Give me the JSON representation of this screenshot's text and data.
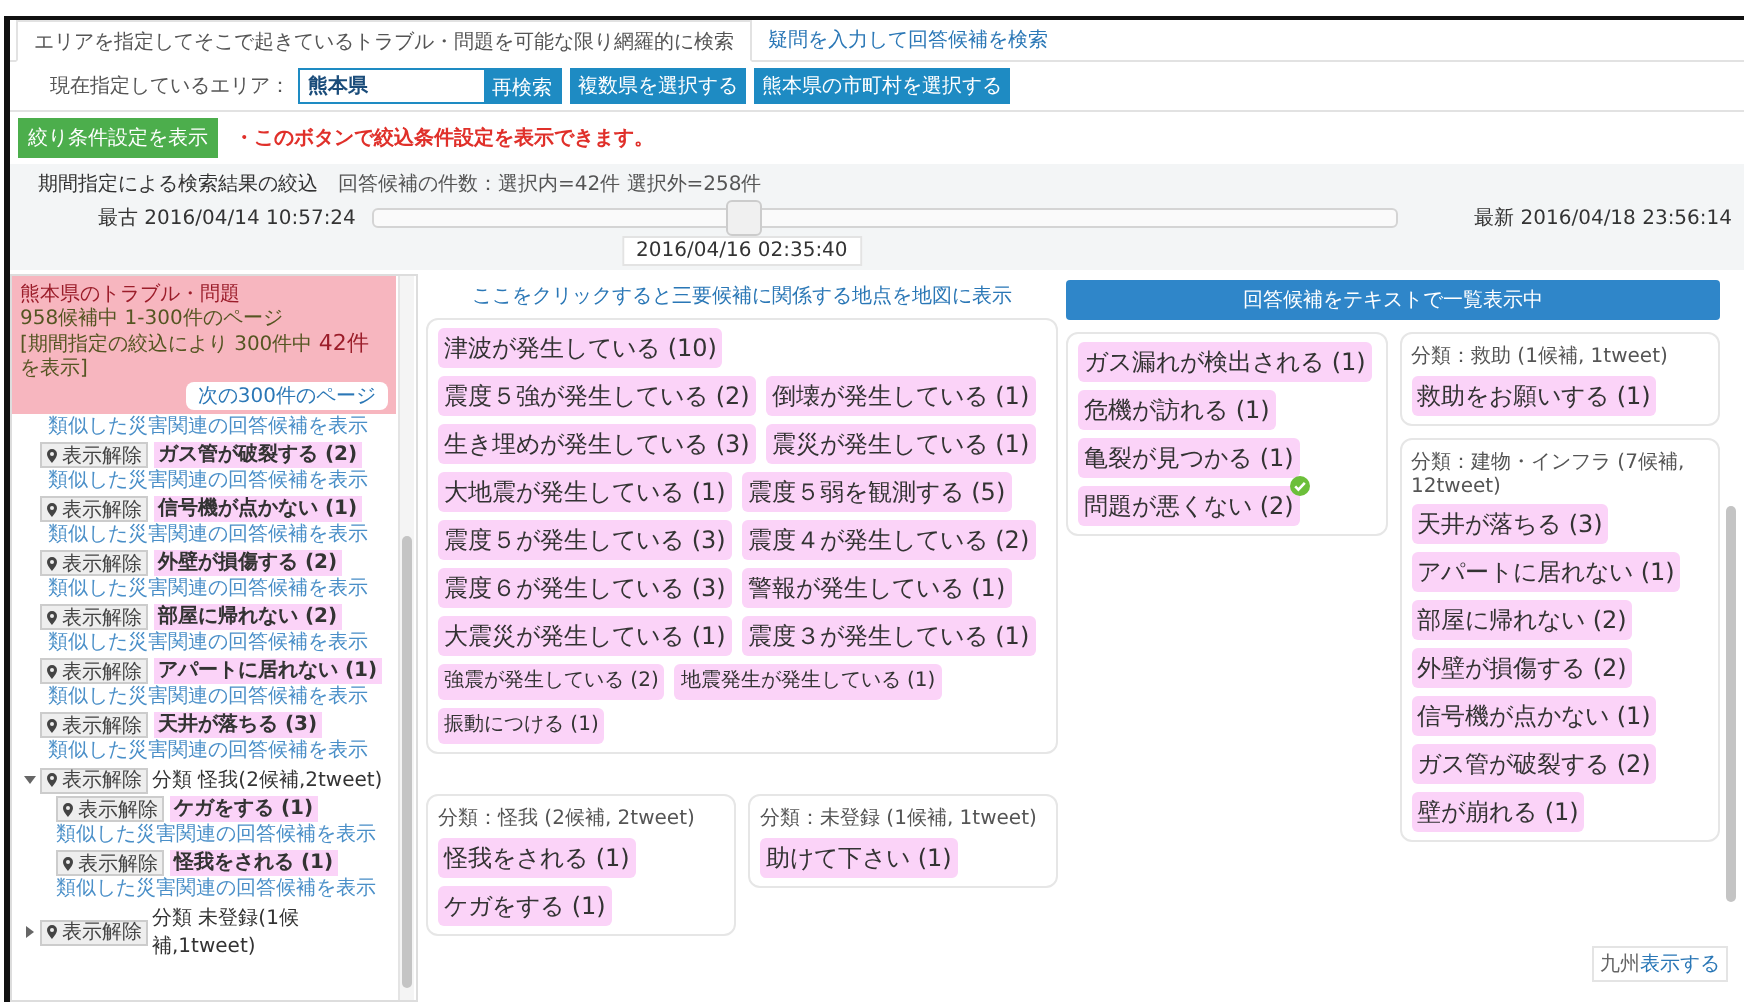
{
  "tabs": [
    {
      "label": "エリアを指定してそこで起きているトラブル・問題を可能な限り網羅的に検索",
      "selected": true
    },
    {
      "label": "疑問を入力して回答候補を検索",
      "selected": false
    }
  ],
  "area": {
    "label": "現在指定しているエリア：",
    "value": "熊本県",
    "buttons": [
      "再検索",
      "複数県を選択する",
      "熊本県の市町村を選択する"
    ]
  },
  "filter": {
    "button": "絞り条件設定を表示",
    "hint": "・このボタンで絞込条件設定を表示できます。"
  },
  "period": {
    "title": "期間指定による検索結果の絞込",
    "counts": "回答候補の件数：選択内=42件 選択外=258件",
    "oldest": "最古 2016/04/14 10:57:24",
    "newest": "最新 2016/04/18 23:56:14",
    "level": 0.36,
    "thumb_time": "2016/04/16 02:35:40"
  },
  "left_panel": {
    "title": "熊本県のトラブル・問題",
    "count": "958候補中 1-300件のページ",
    "note": "[期間指定の絞込により 300件中 **42件**を表示]",
    "next_button": "次の300件のページ",
    "items": [
      {
        "kind": "link",
        "text": "類似した災害関連の回答候補を表示"
      },
      {
        "kind": "answer",
        "pin": "表示解除",
        "text": "ガス管が破裂する (2)",
        "link": "類似した災害関連の回答候補を表示"
      },
      {
        "kind": "answer",
        "pin": "表示解除",
        "text": "信号機が点かない (1)",
        "link": "類似した災害関連の回答候補を表示"
      },
      {
        "kind": "answer",
        "pin": "表示解除",
        "text": "外壁が損傷する (2)",
        "link": "類似した災害関連の回答候補を表示"
      },
      {
        "kind": "answer",
        "pin": "表示解除",
        "text": "部屋に帰れない (2)",
        "link": "類似した災害関連の回答候補を表示"
      },
      {
        "kind": "answer",
        "pin": "表示解除",
        "text": "アパートに居れない (1)",
        "link": "類似した災害関連の回答候補を表示"
      },
      {
        "kind": "answer",
        "pin": "表示解除",
        "text": "天井が落ちる (3)",
        "link": "類似した災害関連の回答候補を表示"
      },
      {
        "kind": "group",
        "expanded": true,
        "pin": "表示解除",
        "text": "分類 怪我(2候補,2tweet)",
        "children": [
          {
            "kind": "answer",
            "pin": "表示解除",
            "text": "ケガをする (1)",
            "link": "類似した災害関連の回答候補を表示"
          },
          {
            "kind": "answer",
            "pin": "表示解除",
            "text": "怪我をされる (1)",
            "link": "類似した災害関連の回答候補を表示"
          }
        ]
      },
      {
        "kind": "group",
        "expanded": false,
        "pin": "表示解除",
        "text": "分類 未登録(1候補,1tweet)"
      }
    ]
  },
  "map_link": "ここをクリックすると三要候補に関係する地点を地図に表示",
  "middle_cards": [
    {
      "tags": [
        {
          "text": "津波が発生している (10)",
          "kind": "large",
          "checked": false
        },
        {
          "text": "震度５強が発生している (2)",
          "kind": "large",
          "checked": false
        },
        {
          "text": "倒壊が発生している (1)",
          "kind": "large",
          "checked": false
        },
        {
          "text": "生き埋めが発生している (3)",
          "kind": "large",
          "checked": false
        },
        {
          "text": "震災が発生している (1)",
          "kind": "large",
          "checked": false
        },
        {
          "text": "大地震が発生している (1)",
          "kind": "large",
          "checked": false
        },
        {
          "text": "震度５弱を観測する (5)",
          "kind": "large",
          "checked": false
        },
        {
          "text": "震度５が発生している (3)",
          "kind": "large",
          "checked": false
        },
        {
          "text": "震度４が発生している (2)",
          "kind": "large",
          "checked": false
        },
        {
          "text": "震度６が発生している (3)",
          "kind": "large",
          "checked": false
        },
        {
          "text": "警報が発生している (1)",
          "kind": "large",
          "checked": false
        },
        {
          "text": "大震災が発生している (1)",
          "kind": "large",
          "checked": false
        },
        {
          "text": "震度３が発生している (1)",
          "kind": "large",
          "checked": false
        },
        {
          "text": "強震が発生している (2)",
          "kind": "small",
          "checked": false
        },
        {
          "text": "地震発生が発生している (1)",
          "kind": "small",
          "checked": false
        },
        {
          "text": "振動につける (1)",
          "kind": "small",
          "checked": false
        }
      ]
    }
  ],
  "middle_bottom_cards": [
    {
      "title": "分類：怪我 (2候補, 2tweet)",
      "tags": [
        {
          "text": "怪我をされる (1)",
          "kind": "large",
          "checked": false
        },
        {
          "text": "ケガをする (1)",
          "kind": "large",
          "checked": false
        }
      ]
    },
    {
      "title": "分類：未登録 (1候補, 1tweet)",
      "tags": [
        {
          "text": "助けて下さい (1)",
          "kind": "large",
          "checked": false
        }
      ]
    }
  ],
  "text_list_bar": "回答候補をテキストで一覧表示中",
  "right_columns": [
    [
      {
        "tags": [
          {
            "text": "ガス漏れが検出される (1)",
            "kind": "large",
            "checked": false
          },
          {
            "text": "危機が訪れる (1)",
            "kind": "large",
            "checked": false
          },
          {
            "text": "亀裂が見つかる (1)",
            "kind": "large",
            "checked": false
          },
          {
            "text": "問題が悪くない (2)",
            "kind": "large",
            "checked": true
          }
        ]
      }
    ],
    [
      {
        "title": "分類：救助 (1候補, 1tweet)",
        "tags": [
          {
            "text": "救助をお願いする (1)",
            "kind": "large",
            "checked": false
          }
        ]
      },
      {
        "title": "分類：建物・インフラ (7候補, 12tweet)",
        "tags": [
          {
            "text": "天井が落ちる (3)",
            "kind": "large",
            "checked": false
          },
          {
            "text": "アパートに居れない (1)",
            "kind": "large",
            "checked": false
          },
          {
            "text": "部屋に帰れない (2)",
            "kind": "large",
            "checked": false
          },
          {
            "text": "外壁が損傷する (2)",
            "kind": "large",
            "checked": false
          },
          {
            "text": "信号機が点かない (1)",
            "kind": "large",
            "checked": false
          },
          {
            "text": "ガス管が破裂する (2)",
            "kind": "large",
            "checked": false
          },
          {
            "text": "壁が崩れる (1)",
            "kind": "large",
            "checked": false
          }
        ]
      }
    ]
  ],
  "corner_button": {
    "label": "九州",
    "link": "表示する"
  }
}
